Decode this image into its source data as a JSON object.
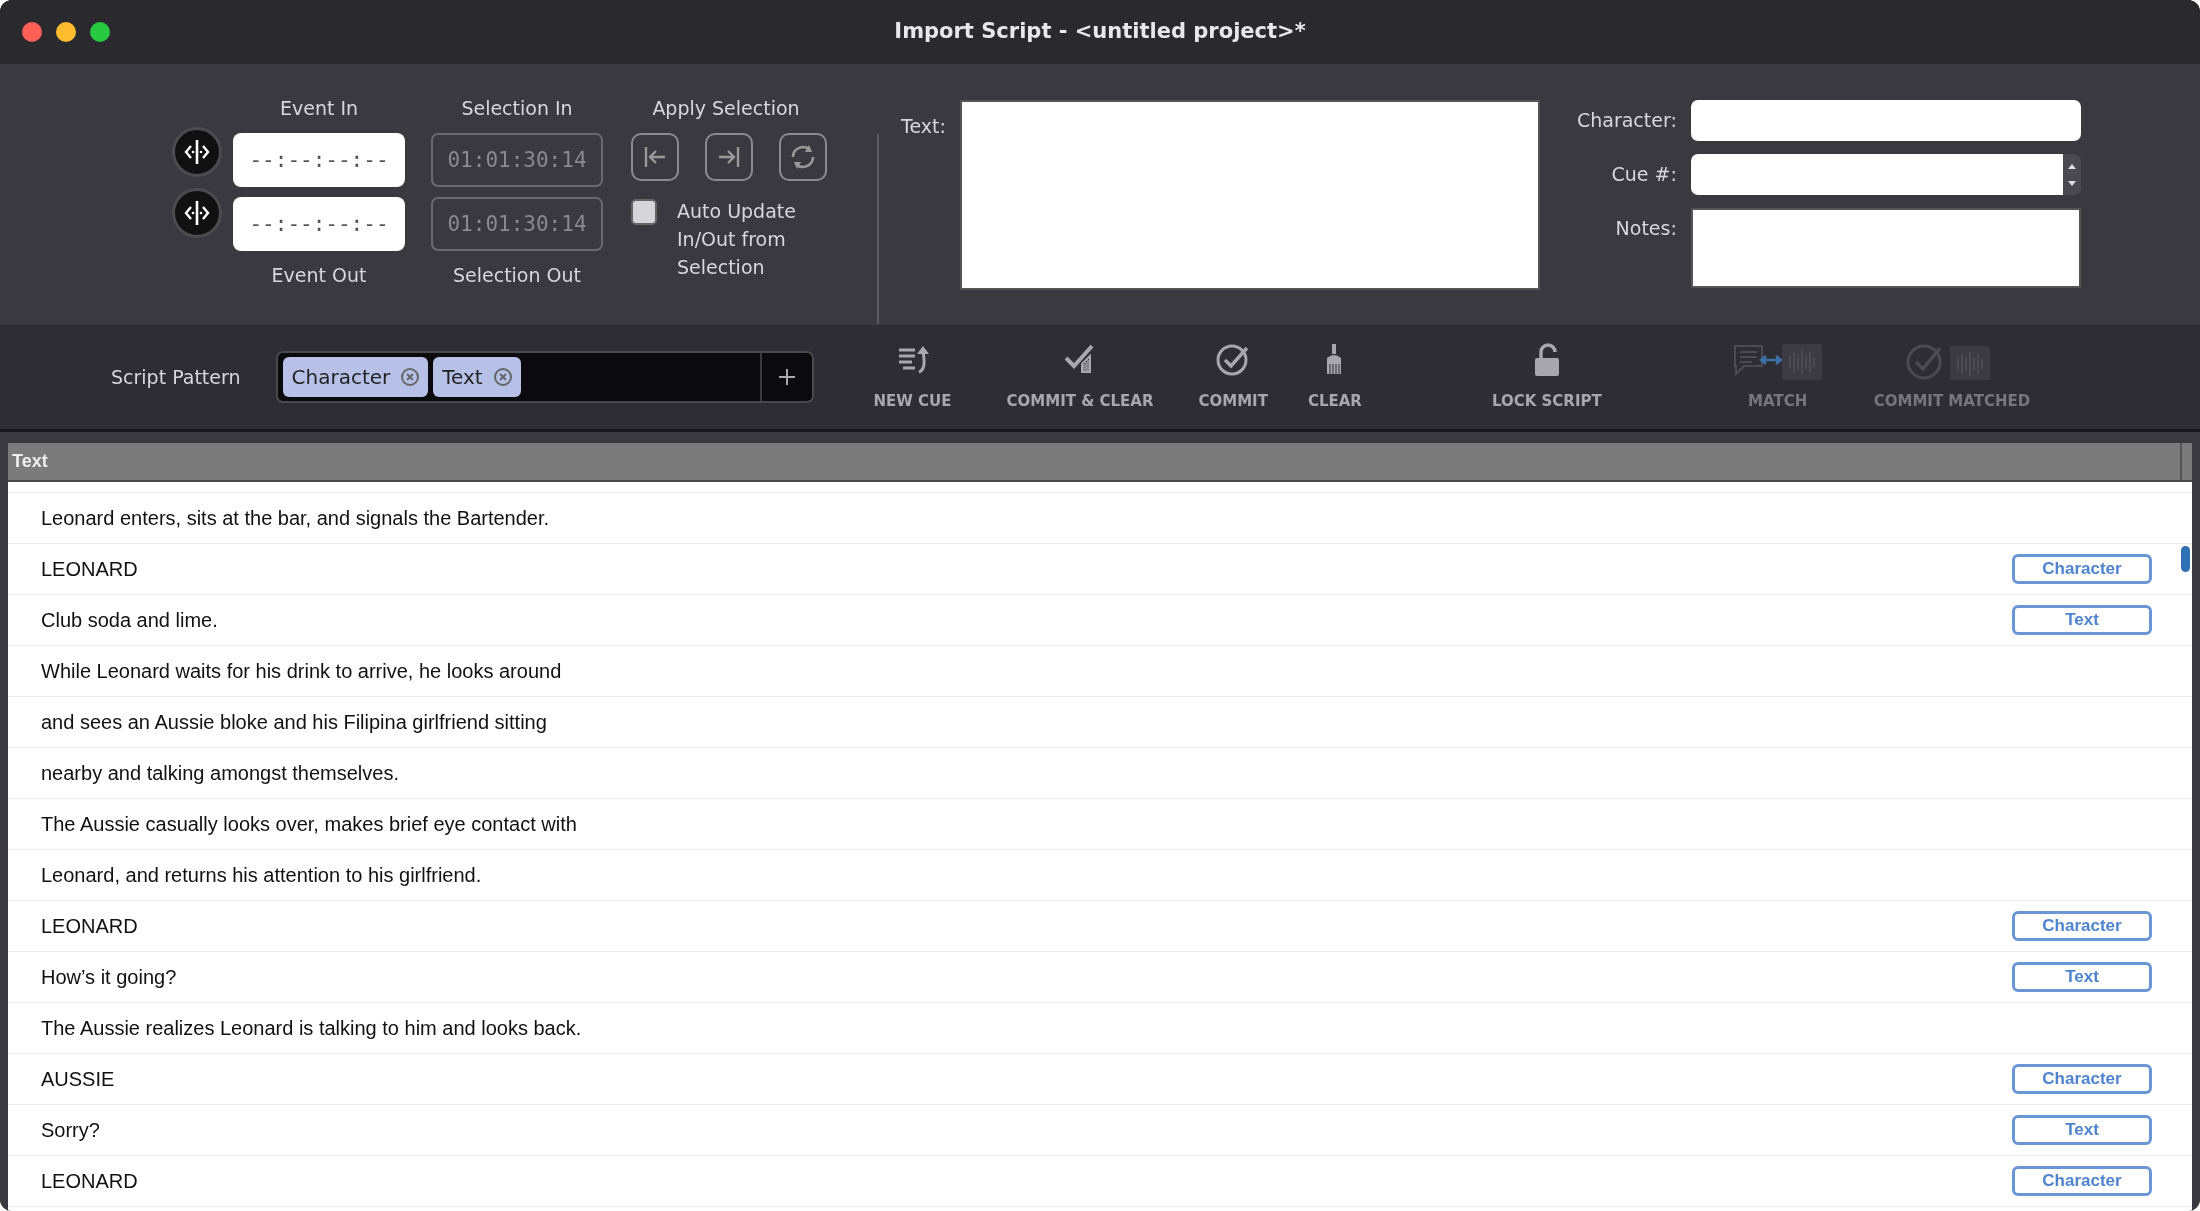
{
  "window": {
    "title": "Import Script - <untitled project>*"
  },
  "timecode": {
    "event_in": {
      "label": "Event In",
      "placeholder": "--:--:--:--"
    },
    "event_out": {
      "label": "Event Out",
      "placeholder": "--:--:--:--"
    },
    "selection_in": {
      "label": "Selection In",
      "value": "01:01:30:14",
      "disabled": true
    },
    "selection_out": {
      "label": "Selection Out",
      "value": "01:01:30:14",
      "disabled": true
    },
    "apply_selection": {
      "label": "Apply Selection"
    },
    "auto_update": {
      "label": "Auto Update In/Out from Selection",
      "checked": false
    }
  },
  "fields": {
    "text": {
      "label": "Text:"
    },
    "character": {
      "label": "Character:"
    },
    "cue": {
      "label": "Cue #:"
    },
    "notes": {
      "label": "Notes:"
    }
  },
  "script_pattern": {
    "label": "Script Pattern",
    "tokens": [
      "Character",
      "Text"
    ]
  },
  "toolbar": [
    {
      "kind": "newcue",
      "label": "NEW CUE",
      "disabled": false
    },
    {
      "kind": "commitclear",
      "label": "COMMIT & CLEAR",
      "disabled": false
    },
    {
      "kind": "commit",
      "label": "COMMIT",
      "disabled": false
    },
    {
      "kind": "clear",
      "label": "CLEAR",
      "disabled": false
    },
    {
      "kind": "lock",
      "label": "LOCK SCRIPT",
      "disabled": false
    },
    {
      "kind": "match",
      "label": "MATCH",
      "disabled": true
    },
    {
      "kind": "commitmatched",
      "label": "COMMIT MATCHED",
      "disabled": true
    }
  ],
  "table": {
    "columns": [
      "Text"
    ],
    "rows": [
      {
        "text": "Leonard enters, sits at the bar, and signals the Bartender."
      },
      {
        "text": "LEONARD",
        "tag": "Character"
      },
      {
        "text": "Club soda and lime.",
        "tag": "Text"
      },
      {
        "text": "While Leonard waits for his drink to arrive, he looks around"
      },
      {
        "text": "and sees an Aussie bloke and his Filipina girlfriend sitting"
      },
      {
        "text": "nearby and talking amongst themselves."
      },
      {
        "text": "The Aussie casually looks over, makes brief eye contact with"
      },
      {
        "text": "Leonard, and returns his attention to his girlfriend."
      },
      {
        "text": "LEONARD",
        "tag": "Character"
      },
      {
        "text": "How’s it going?",
        "tag": "Text"
      },
      {
        "text": "The Aussie realizes Leonard is talking to him and looks back."
      },
      {
        "text": "AUSSIE",
        "tag": "Character"
      },
      {
        "text": "Sorry?",
        "tag": "Text"
      },
      {
        "text": "LEONARD",
        "tag": "Character"
      }
    ]
  }
}
